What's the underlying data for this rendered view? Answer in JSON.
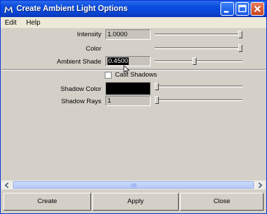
{
  "window": {
    "title": "Create Ambient Light Options"
  },
  "menu": {
    "items": [
      "Edit",
      "Help"
    ]
  },
  "fields": {
    "intensity": {
      "label": "Intensity",
      "value": "1.0000",
      "slider": 1.0
    },
    "color": {
      "label": "Color",
      "slider": 1.0
    },
    "ambient_shade": {
      "label": "Ambient Shade",
      "value": "0.4500",
      "slider": 0.45
    },
    "cast_shadows": {
      "label": "Cast Shadows",
      "checked": false
    },
    "shadow_color": {
      "label": "Shadow Color",
      "color": "#000000",
      "slider": 0.0
    },
    "shadow_rays": {
      "label": "Shadow Rays",
      "value": "1",
      "slider": 0.0
    }
  },
  "buttons": {
    "create": "Create",
    "apply": "Apply",
    "close": "Close"
  }
}
